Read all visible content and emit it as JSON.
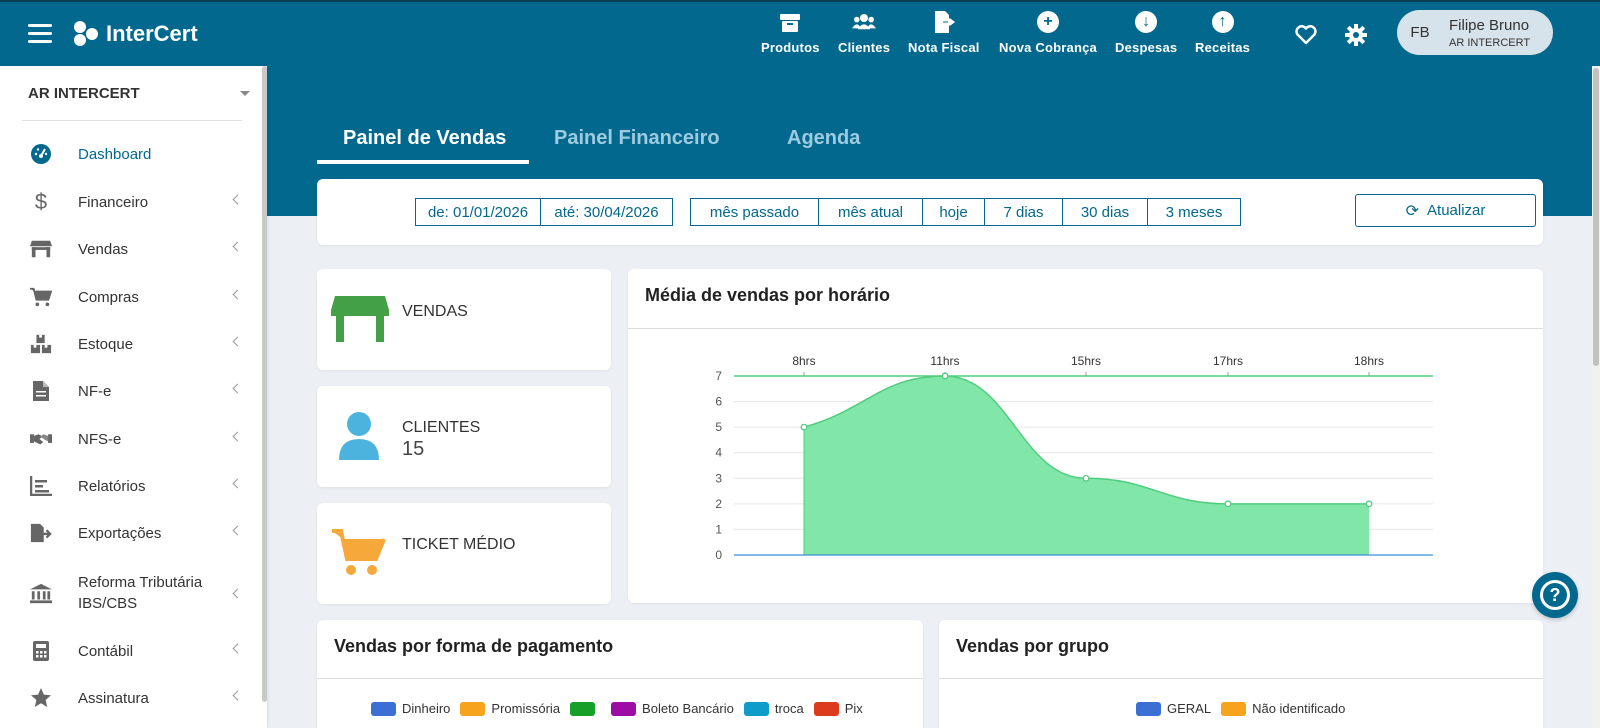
{
  "header": {
    "brand": "InterCert",
    "nav": [
      {
        "label": "Produtos",
        "icon": "box-icon"
      },
      {
        "label": "Clientes",
        "icon": "users-icon"
      },
      {
        "label": "Nota Fiscal",
        "icon": "file-export-icon"
      },
      {
        "label": "Nova Cobrança",
        "icon": "plus-circle-icon"
      },
      {
        "label": "Despesas",
        "icon": "arrow-down-circle-icon"
      },
      {
        "label": "Receitas",
        "icon": "arrow-up-circle-icon"
      }
    ],
    "user": {
      "initials": "FB",
      "name": "Filipe Bruno",
      "org": "AR INTERCERT"
    }
  },
  "sidebar": {
    "company": "AR INTERCERT",
    "items": [
      {
        "label": "Dashboard",
        "icon": "dashboard-gauge-icon",
        "active": true
      },
      {
        "label": "Financeiro",
        "icon": "dollar-icon"
      },
      {
        "label": "Vendas",
        "icon": "store-icon"
      },
      {
        "label": "Compras",
        "icon": "cart-icon"
      },
      {
        "label": "Estoque",
        "icon": "boxes-icon"
      },
      {
        "label": "NF-e",
        "icon": "file-icon"
      },
      {
        "label": "NFS-e",
        "icon": "handshake-icon"
      },
      {
        "label": "Relatórios",
        "icon": "chart-icon"
      },
      {
        "label": "Exportações",
        "icon": "export-icon"
      },
      {
        "label": "Reforma Tributária\nIBS/CBS",
        "line1": "Reforma Tributária",
        "line2": "IBS/CBS",
        "icon": "bank-icon"
      },
      {
        "label": "Contábil",
        "icon": "calculator-icon"
      },
      {
        "label": "Assinatura",
        "icon": "star-icon"
      }
    ]
  },
  "tabs": [
    {
      "label": "Painel de Vendas",
      "active": true
    },
    {
      "label": "Painel Financeiro"
    },
    {
      "label": "Agenda"
    }
  ],
  "filters": {
    "from": "de: 01/01/2026",
    "to": "até: 30/04/2026",
    "presets": [
      "mês passado",
      "mês atual",
      "hoje",
      "7 dias",
      "30 dias",
      "3 meses"
    ],
    "refresh_label": "Atualizar"
  },
  "stats": {
    "vendas": {
      "label": "VENDAS",
      "value": ""
    },
    "clientes": {
      "label": "CLIENTES",
      "value": "15"
    },
    "ticket": {
      "label": "TICKET MÉDIO",
      "value": ""
    }
  },
  "chart_data": {
    "type": "area",
    "title": "Média de vendas por horário",
    "categories": [
      "8hrs",
      "11hrs",
      "15hrs",
      "17hrs",
      "18hrs"
    ],
    "values": [
      5,
      7,
      3,
      2,
      2
    ],
    "ylim": [
      0,
      7
    ],
    "yticks": [
      0,
      1,
      2,
      3,
      4,
      5,
      6,
      7
    ],
    "grid": true,
    "color": "#7ae6a4",
    "line_color": "#52cc7f"
  },
  "payment": {
    "title": "Vendas por forma de pagamento",
    "legend": [
      {
        "label": "Dinheiro",
        "color": "#3b6fd4"
      },
      {
        "label": "Promissória",
        "color": "#f8a31d"
      },
      {
        "label": "",
        "color": "#16a02a"
      },
      {
        "label": "Boleto Bancário",
        "color": "#9c0ea3"
      },
      {
        "label": "troca",
        "color": "#0e9dc9"
      },
      {
        "label": "Pix",
        "color": "#dd3b1e"
      }
    ]
  },
  "group": {
    "title": "Vendas por grupo",
    "legend": [
      {
        "label": "GERAL",
        "color": "#3b6fd4"
      },
      {
        "label": "Não identificado",
        "color": "#f8a31d"
      }
    ]
  },
  "colors": {
    "primary": "#02688d",
    "background": "#ecf0f5"
  }
}
